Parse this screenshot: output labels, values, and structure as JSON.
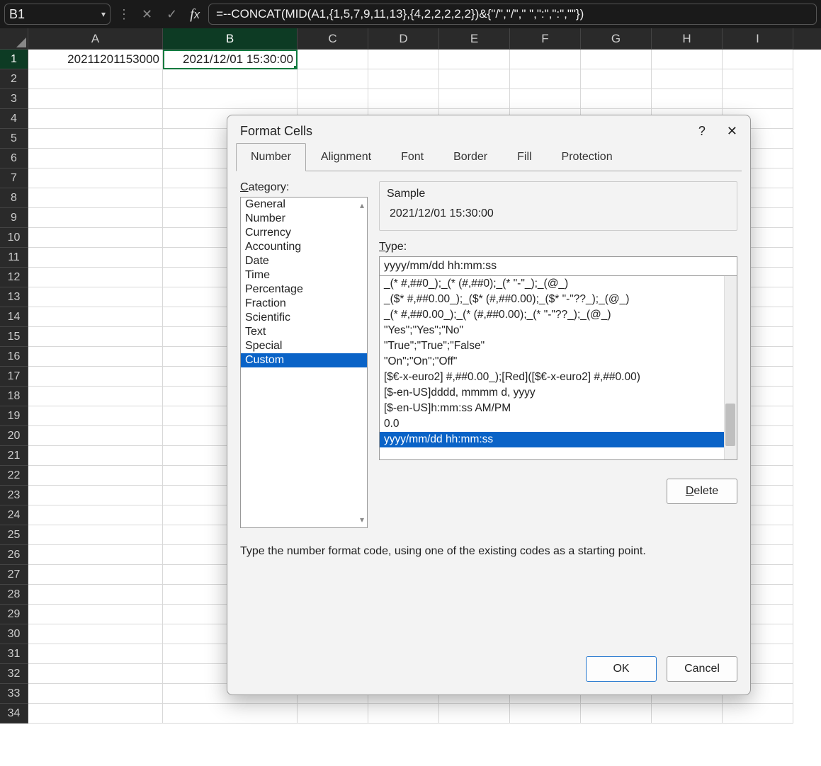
{
  "name_box": "B1",
  "formula": "=--CONCAT(MID(A1,{1,5,7,9,11,13},{4,2,2,2,2,2})&{\"/\",\"/\",\" \",\":\",\":\",\"\"})",
  "columns": [
    "A",
    "B",
    "C",
    "D",
    "E",
    "F",
    "G",
    "H",
    "I"
  ],
  "rows": [
    "1",
    "2",
    "3",
    "4",
    "5",
    "6",
    "7",
    "8",
    "9",
    "10",
    "11",
    "12",
    "13",
    "14",
    "15",
    "16",
    "17",
    "18",
    "19",
    "20",
    "21",
    "22",
    "23",
    "24",
    "25",
    "26",
    "27",
    "28",
    "29",
    "30",
    "31",
    "32",
    "33",
    "34"
  ],
  "cells": {
    "A1": "20211201153000",
    "B1": "2021/12/01 15:30:00"
  },
  "dialog": {
    "title": "Format Cells",
    "help_icon": "?",
    "close_icon": "✕",
    "tabs": [
      "Number",
      "Alignment",
      "Font",
      "Border",
      "Fill",
      "Protection"
    ],
    "category_label": "Category:",
    "categories": [
      "General",
      "Number",
      "Currency",
      "Accounting",
      "Date",
      "Time",
      "Percentage",
      "Fraction",
      "Scientific",
      "Text",
      "Special",
      "Custom"
    ],
    "sample_label": "Sample",
    "sample_value": "2021/12/01 15:30:00",
    "type_label": "Type:",
    "type_value": "yyyy/mm/dd hh:mm:ss",
    "formats": [
      "_(* #,##0_);_(* (#,##0);_(* \"-\"_);_(@_)",
      "_($* #,##0.00_);_($* (#,##0.00);_($* \"-\"??_);_(@_)",
      "_(* #,##0.00_);_(* (#,##0.00);_(* \"-\"??_);_(@_)",
      "\"Yes\";\"Yes\";\"No\"",
      "\"True\";\"True\";\"False\"",
      "\"On\";\"On\";\"Off\"",
      "[$€-x-euro2] #,##0.00_);[Red]([$€-x-euro2] #,##0.00)",
      "[$-en-US]dddd, mmmm d, yyyy",
      "[$-en-US]h:mm:ss AM/PM",
      "0.0",
      "yyyy/mm/dd hh:mm:ss"
    ],
    "delete_label": "Delete",
    "help_text": "Type the number format code, using one of the existing codes as a starting point.",
    "ok_label": "OK",
    "cancel_label": "Cancel"
  }
}
